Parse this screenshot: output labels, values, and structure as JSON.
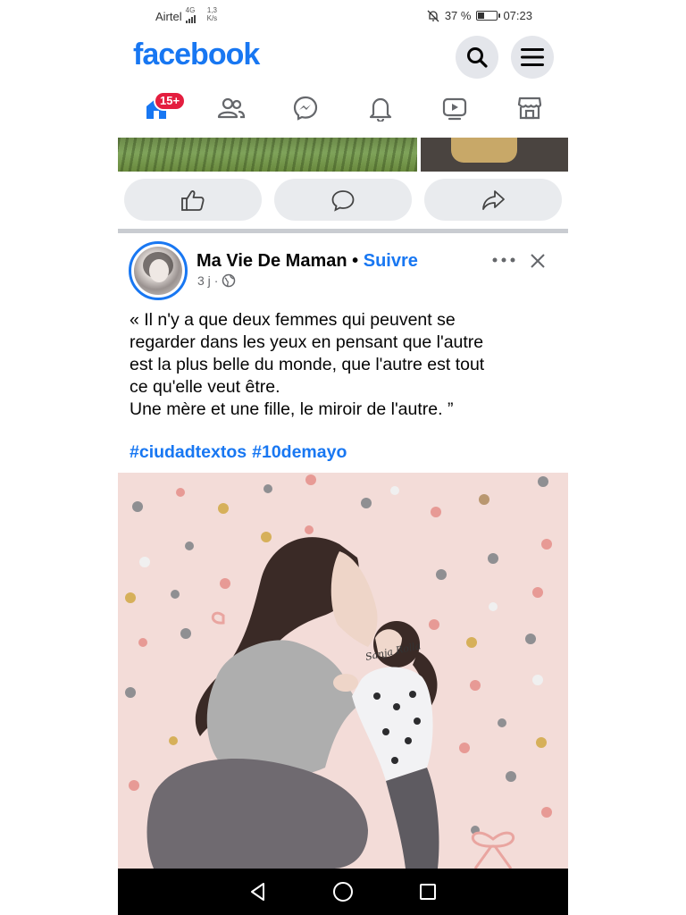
{
  "status_bar": {
    "carrier": "Airtel",
    "network": "4G",
    "speed_value": "1,3",
    "speed_unit": "K/s",
    "battery_percent": "37 %",
    "battery_level": 0.37,
    "time": "07:23"
  },
  "header": {
    "logo": "facebook",
    "search_icon": "search-icon",
    "menu_icon": "hamburger-menu-icon"
  },
  "nav": {
    "items": [
      {
        "name": "home",
        "icon": "home-icon",
        "badge": "15+",
        "active": true
      },
      {
        "name": "friends",
        "icon": "friends-icon"
      },
      {
        "name": "messenger",
        "icon": "messenger-icon"
      },
      {
        "name": "notifications",
        "icon": "bell-icon"
      },
      {
        "name": "watch",
        "icon": "video-icon"
      },
      {
        "name": "marketplace",
        "icon": "store-icon"
      }
    ]
  },
  "previous_post_actions": [
    {
      "name": "like",
      "icon": "like-icon"
    },
    {
      "name": "comment",
      "icon": "comment-icon"
    },
    {
      "name": "share",
      "icon": "share-icon"
    }
  ],
  "post": {
    "author": "Ma Vie De Maman",
    "separator": "•",
    "follow_label": "Suivre",
    "time": "3 j",
    "meta_sep": "·",
    "privacy_icon": "globe-icon",
    "text": "« Il n'y a que deux femmes qui peuvent se\nregarder dans les yeux en pensant que l'autre\nest la plus belle du monde, que l'autre est tout\nce qu'elle veut être.\nUne mère et une fille, le miroir de l'autre. ”",
    "hashtags": [
      "#ciudadtextos",
      "#10demayo"
    ],
    "image_signature": "Sanja Rolla"
  },
  "colors": {
    "brand": "#1877f2",
    "badge": "#e41e3f",
    "button_bg": "#e4e6eb",
    "image_bg": "#f3dcd8"
  }
}
